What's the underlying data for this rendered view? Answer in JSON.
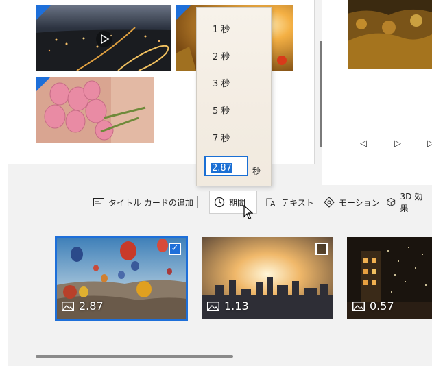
{
  "duration_menu": {
    "options": [
      "1 秒",
      "2 秒",
      "3 秒",
      "5 秒",
      "7 秒"
    ],
    "custom_value": "2.87",
    "unit": "秒"
  },
  "toolbar": {
    "add_title_card": "タイトル カードの追加",
    "duration": "期間",
    "text": "テキスト",
    "motion": "モーション",
    "effects_3d": "3D 効果"
  },
  "storyboard": {
    "cards": [
      {
        "duration": "2.87",
        "selected": true
      },
      {
        "duration": "1.13",
        "selected": false
      },
      {
        "duration": "0.57",
        "selected": false
      }
    ]
  },
  "colors": {
    "accent": "#1e6fd9"
  }
}
